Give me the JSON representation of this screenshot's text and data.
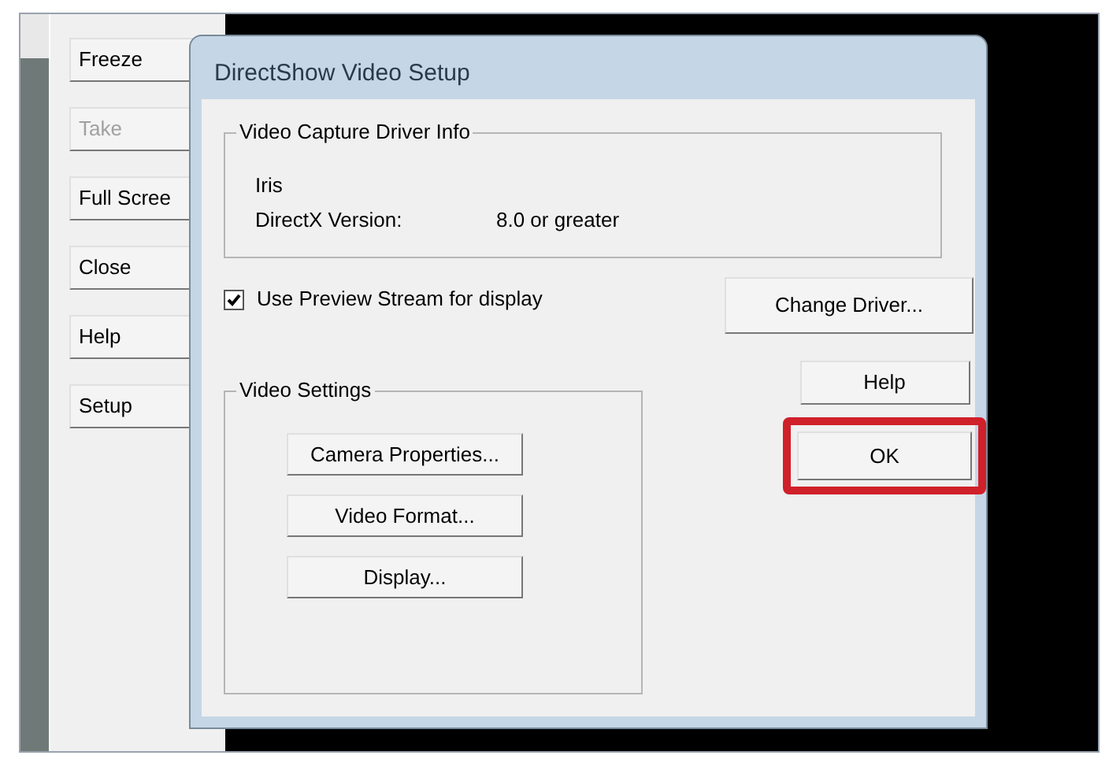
{
  "sidebar": {
    "buttons": [
      {
        "label": "Freeze",
        "disabled": false
      },
      {
        "label": "Take",
        "disabled": true
      },
      {
        "label": "Full Scree",
        "disabled": false
      },
      {
        "label": "Close",
        "disabled": false
      },
      {
        "label": "Help",
        "disabled": false
      },
      {
        "label": "Setup",
        "disabled": false
      }
    ]
  },
  "dialog": {
    "title": "DirectShow Video Setup",
    "driver_info": {
      "title": "Video Capture Driver Info",
      "driver_name": "Iris",
      "directx_label": "DirectX Version:",
      "directx_value": "8.0 or greater"
    },
    "preview_checkbox": {
      "label": "Use Preview Stream for display",
      "checked": true
    },
    "change_driver_button": "Change Driver...",
    "video_settings": {
      "title": "Video Settings",
      "buttons": [
        "Camera Properties...",
        "Video Format...",
        "Display..."
      ]
    },
    "help_button": "Help",
    "ok_button": {
      "label": "OK",
      "highlighted": true
    }
  }
}
